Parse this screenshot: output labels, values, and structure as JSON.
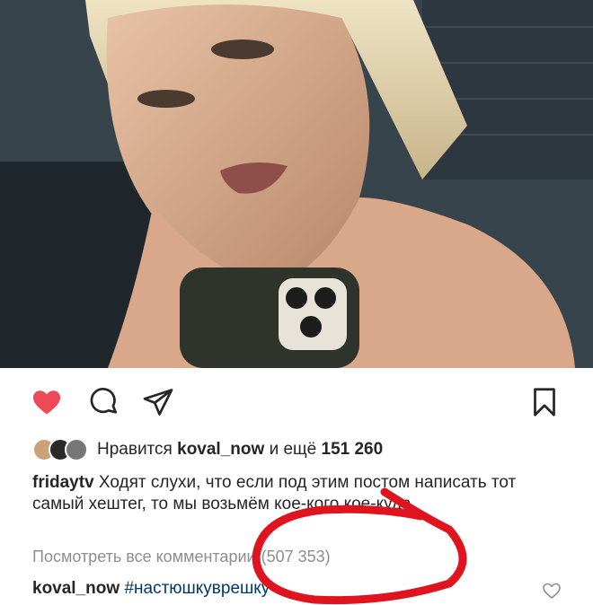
{
  "post": {
    "liked_by_prefix": "Нравится",
    "liked_by_user": "koval_now",
    "liked_by_connector": "и ещё",
    "like_count": "151 260",
    "caption_user": "fridaytv",
    "caption_text": "Ходят слухи, что если под этим постом написать тот самый хештег, то мы возьмём кое-кого кое-куда",
    "view_comments_label": "Посмотреть все комментарии",
    "comment_count": "(507 353)",
    "comment_user": "koval_now",
    "comment_text": "#настюшкуврешку"
  },
  "icons": {
    "like": "heart-filled-icon",
    "comment": "comment-bubble-icon",
    "share": "paper-plane-icon",
    "save": "bookmark-icon",
    "comment_like": "heart-outline-icon"
  },
  "colors": {
    "liked_heart": "#ed4956",
    "hashtag": "#00376b",
    "muted_text": "#8e8e8e",
    "annotation": "#e0141e"
  }
}
